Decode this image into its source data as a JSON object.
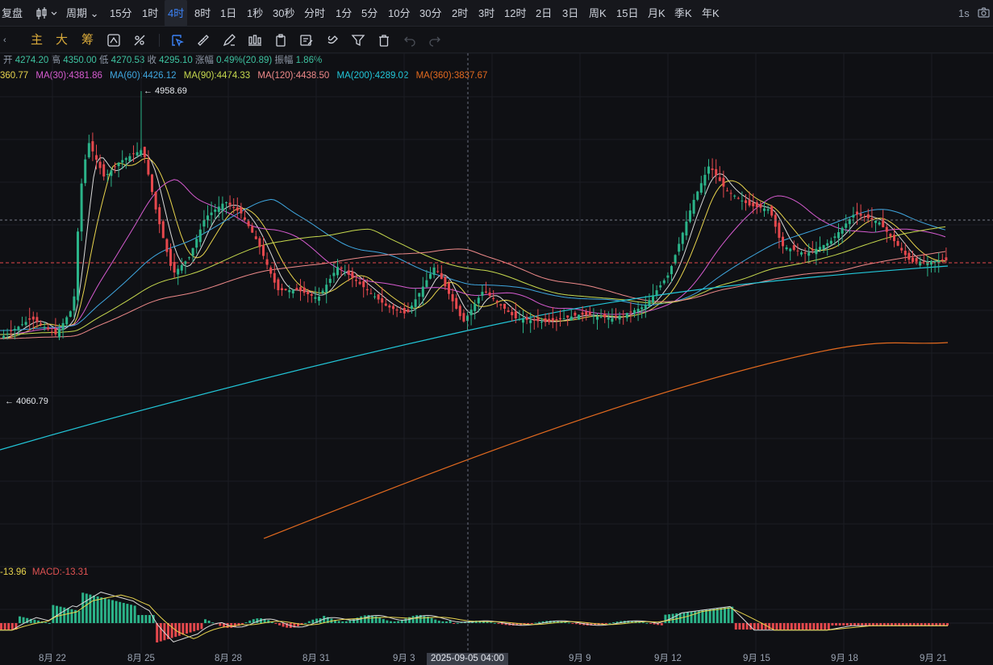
{
  "topbar": {
    "replay": "复盘",
    "period": "周期",
    "timeframes": [
      "15分",
      "1时",
      "4时",
      "8时",
      "1日",
      "1秒",
      "30秒",
      "分时",
      "1分",
      "5分",
      "10分",
      "30分",
      "2时",
      "3时",
      "12时",
      "2日",
      "3日",
      "周K",
      "15日",
      "月K",
      "季K",
      "年K"
    ],
    "active_timeframe": "4时",
    "right_label": "1s"
  },
  "toolbar": {
    "main": "主",
    "big": "大",
    "chips": "筹"
  },
  "ohlc": {
    "open_label": "开",
    "open": "4274.20",
    "high_label": "高",
    "high": "4350.00",
    "low_label": "低",
    "low": "4270.53",
    "close_label": "收",
    "close": "4295.10",
    "change_label": "涨幅",
    "change": "0.49%(20.89)",
    "amp_label": "振幅",
    "amp": "1.86%"
  },
  "ma_legend": [
    {
      "text": "360.77",
      "color": "#e8d44d"
    },
    {
      "text": "MA(30):4381.86",
      "color": "#d65bd0"
    },
    {
      "text": "MA(60):4426.12",
      "color": "#3fa7e0"
    },
    {
      "text": "MA(90):4474.33",
      "color": "#c7d94e"
    },
    {
      "text": "MA(120):4438.50",
      "color": "#ef8a8a"
    },
    {
      "text": "MA(200):4289.02",
      "color": "#22c7d9"
    },
    {
      "text": "MA(360):3837.67",
      "color": "#e36a1f"
    }
  ],
  "price_tags": {
    "high": "← 4958.69",
    "low": "← 4060.79"
  },
  "macd": {
    "left": "-13.96",
    "left_color": "#e8d44d",
    "label": "MACD:-13.31",
    "label_color": "#e05252"
  },
  "x_axis": [
    "8月 22",
    "8月 25",
    "8月 28",
    "8月 31",
    "9月 3",
    "9月 9",
    "9月 12",
    "9月 15",
    "9月 18",
    "9月 21"
  ],
  "crosshair_time": "2025-09-05 04:00",
  "colors": {
    "up": "#2bb389",
    "down": "#e5484d",
    "bg": "#0f1014"
  }
}
